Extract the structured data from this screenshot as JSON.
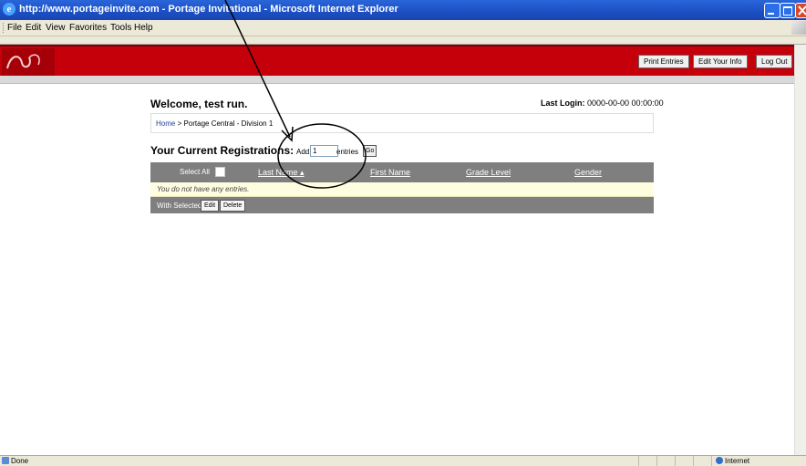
{
  "window": {
    "title": "http://www.portageinvite.com - Portage Invitational - Microsoft Internet Explorer"
  },
  "menu": [
    "File",
    "Edit",
    "View",
    "Favorites",
    "Tools",
    "Help"
  ],
  "header": {
    "buttons": [
      "Print Entries",
      "Edit Your Info",
      "Log Out"
    ]
  },
  "page": {
    "welcome": "Welcome, test run.",
    "last_login_label": "Last Login:",
    "last_login_value": "0000-00-00 00:00:00",
    "breadcrumb_home": "Home",
    "breadcrumb_rest": " > Portage Central - Division 1",
    "registrations_title": "Your Current Registrations:",
    "add_label": "Add",
    "add_value": "1",
    "entries_label": "entries",
    "go_label": "Go"
  },
  "table": {
    "select_all": "Select All",
    "columns": [
      "Last Name ▴",
      "First Name",
      "Grade Level",
      "Gender"
    ],
    "empty_message": "You do not have any entries.",
    "with_selected": "With Selected:",
    "edit_label": "Edit",
    "delete_label": "Delete"
  },
  "status": {
    "left": "Done",
    "zone": "Internet"
  }
}
